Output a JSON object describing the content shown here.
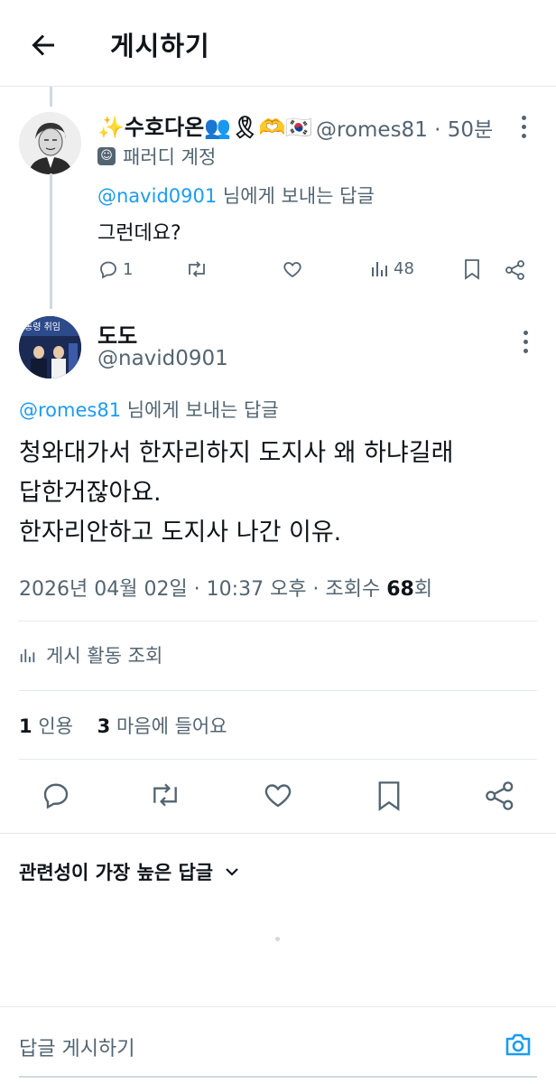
{
  "header": {
    "title": "게시하기"
  },
  "parent_post": {
    "display_name": "✨수호다온👥🎗🫶🇰🇷",
    "handle": "@romes81",
    "time": "· 50분",
    "label": "패러디 계정",
    "reply_to_handle": "@navid0901",
    "reply_to_suffix": " 님에게 보내는 답글",
    "text": "그런데요?",
    "replies": "1",
    "views": "48"
  },
  "main_post": {
    "display_name": "도도",
    "handle": "@navid0901",
    "reply_to_handle": "@romes81",
    "reply_to_suffix": " 님에게 보내는 답글",
    "text_lines": [
      "청와대가서 한자리하지 도지사 왜 하냐길래",
      "답한거잖아요.",
      "한자리안하고 도지사 나간 이유."
    ],
    "datetime": "2026년 04월 02일 · 10:37 오후 · 조회수 ",
    "views_count": "68",
    "views_suffix": "회",
    "activity_label": "게시 활동 조회",
    "quotes_count": "1",
    "quotes_label": "인용",
    "likes_count": "3",
    "likes_label": "마음에 들어요"
  },
  "replies_sort": {
    "label": "관련성이 가장 높은 답글"
  },
  "reply_bar": {
    "placeholder": "답글 게시하기"
  },
  "colors": {
    "accent": "#1d9bf0",
    "muted": "#536471",
    "text": "#0f1419",
    "border": "#e6e9eb"
  }
}
